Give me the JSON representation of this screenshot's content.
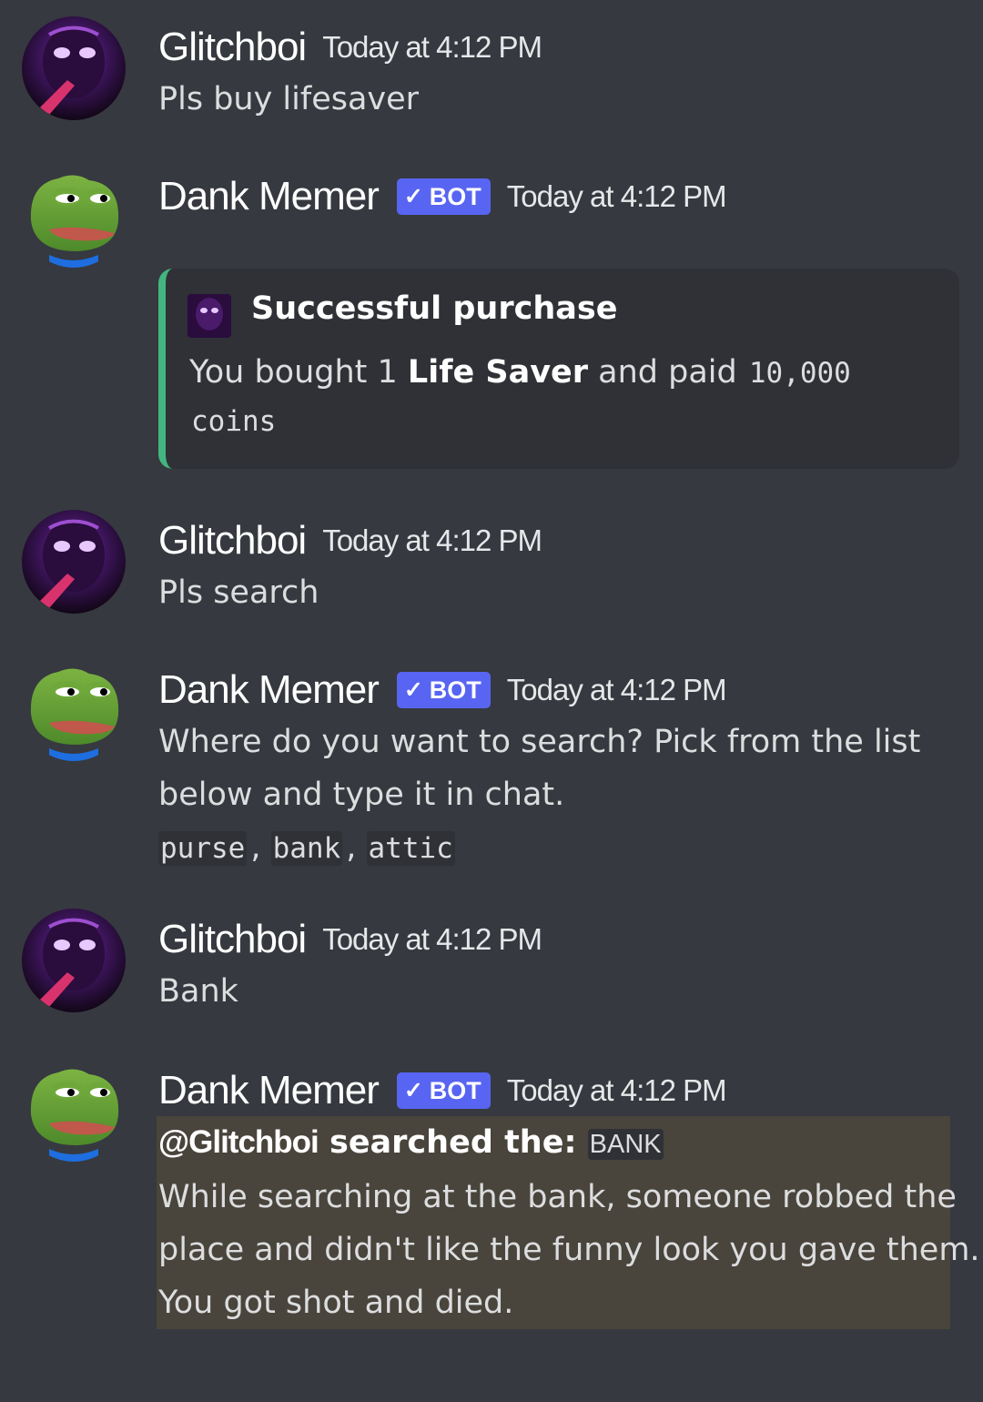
{
  "messages": [
    {
      "author": "Glitchboi",
      "timestamp": "Today at 4:12 PM",
      "text": "Pls buy lifesaver"
    },
    {
      "author": "Dank Memer",
      "bot_tag": "BOT",
      "bot_check": "✓",
      "timestamp": "Today at 4:12 PM",
      "embed": {
        "title": "Successful purchase",
        "accent_color": "#43b581",
        "desc_prefix": "You bought 1 ",
        "desc_item": "Life Saver",
        "desc_mid": " and paid ",
        "desc_amount": "10,000",
        "desc_unit": "coins"
      }
    },
    {
      "author": "Glitchboi",
      "timestamp": "Today at 4:12 PM",
      "text": "Pls search"
    },
    {
      "author": "Dank Memer",
      "bot_tag": "BOT",
      "bot_check": "✓",
      "timestamp": "Today at 4:12 PM",
      "text": "Where do you want to search? Pick from the list below and type it in chat.",
      "options": [
        "purse",
        "bank",
        "attic"
      ],
      "option_separator": ", "
    },
    {
      "author": "Glitchboi",
      "timestamp": "Today at 4:12 PM",
      "text": "Bank"
    },
    {
      "author": "Dank Memer",
      "bot_tag": "BOT",
      "bot_check": "✓",
      "timestamp": "Today at 4:12 PM",
      "mention": "@Glitchboi",
      "searched_label": " searched the: ",
      "location": "BANK",
      "line1": "While searching at the bank, someone robbed the",
      "line2": "place and didn't like the funny look you gave them.",
      "line3": "You got shot and died."
    }
  ],
  "colors": {
    "background": "#36393f",
    "embed_bg": "#2f3136",
    "bot_tag": "#5865f2",
    "highlight": "#49443c"
  },
  "icons": {
    "glitchboi_avatar": "purple-masked-figure",
    "dank_memer_avatar": "pepe-frog",
    "embed_icon": "purple-masked-figure"
  }
}
